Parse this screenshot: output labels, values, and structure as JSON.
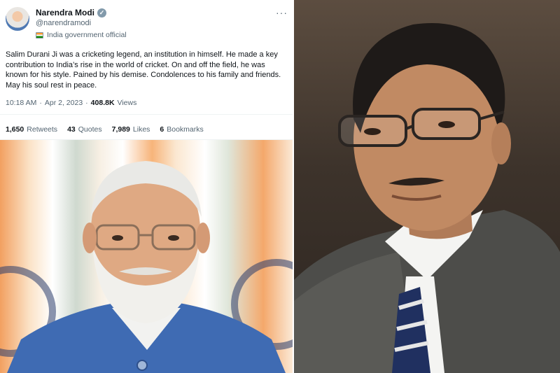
{
  "tweet": {
    "author_name": "Narendra Modi",
    "verified_icon": "verified-badge-icon",
    "handle": "@narendramodi",
    "affiliation": "India government official",
    "more_icon": "more-options-icon",
    "more_glyph": "···",
    "text": "Salim Durani Ji was a cricketing legend, an institution in himself. He made a key contribution to India’s rise in the world of cricket. On and off the field, he was known for his style. Pained by his demise. Condolences to his family and friends. May his soul rest in peace.",
    "time": "10:18 AM",
    "separator": "·",
    "date": "Apr 2, 2023",
    "views_count": "408.8K",
    "views_label": "Views",
    "stats": [
      {
        "count": "1,650",
        "label": "Retweets"
      },
      {
        "count": "43",
        "label": "Quotes"
      },
      {
        "count": "7,989",
        "label": "Likes"
      },
      {
        "count": "6",
        "label": "Bookmarks"
      }
    ]
  },
  "colors": {
    "text_primary": "#0f1419",
    "text_secondary": "#536471",
    "verified_badge": "#829aab",
    "divider": "#eff3f4"
  }
}
